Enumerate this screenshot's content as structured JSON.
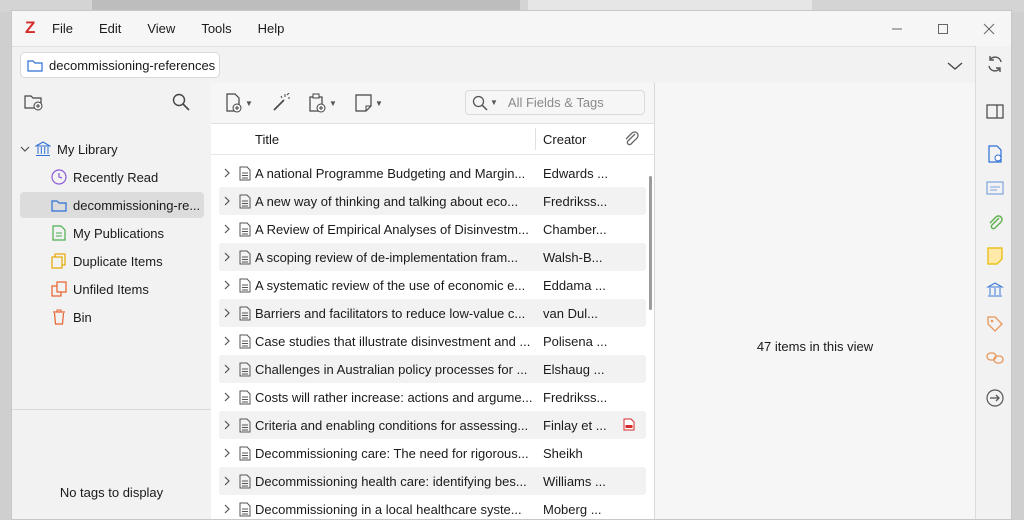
{
  "app": {
    "logo": "Z"
  },
  "menu": [
    "File",
    "Edit",
    "View",
    "Tools",
    "Help"
  ],
  "tab": {
    "label": "decommissioning-references"
  },
  "sidebar": {
    "library": "My Library",
    "items": [
      {
        "label": "Recently Read",
        "icon": "clock-icon"
      },
      {
        "label": "decommissioning-re...",
        "icon": "folder-icon",
        "selected": true
      },
      {
        "label": "My Publications",
        "icon": "publications-icon"
      },
      {
        "label": "Duplicate Items",
        "icon": "duplicate-icon"
      },
      {
        "label": "Unfiled Items",
        "icon": "unfiled-icon"
      },
      {
        "label": "Bin",
        "icon": "trash-icon"
      }
    ],
    "tags_message": "No tags to display"
  },
  "search": {
    "placeholder": "All Fields & Tags"
  },
  "columns": {
    "title": "Title",
    "creator": "Creator"
  },
  "rows": [
    {
      "title": "A national Programme Budgeting and Margin...",
      "creator": "Edwards ...",
      "pdf": false
    },
    {
      "title": "A new way of thinking and talking about eco...",
      "creator": "Fredrikss...",
      "pdf": false
    },
    {
      "title": "A Review of Empirical Analyses of Disinvestm...",
      "creator": "Chamber...",
      "pdf": false
    },
    {
      "title": "A scoping review of de-implementation fram...",
      "creator": "Walsh-B...",
      "pdf": false
    },
    {
      "title": "A systematic review of the use of economic e...",
      "creator": "Eddama ...",
      "pdf": false
    },
    {
      "title": "Barriers and facilitators to reduce low-value c...",
      "creator": "van Dul...",
      "pdf": false
    },
    {
      "title": "Case studies that illustrate disinvestment and ...",
      "creator": "Polisena ...",
      "pdf": false
    },
    {
      "title": "Challenges in Australian policy processes for ...",
      "creator": "Elshaug ...",
      "pdf": false
    },
    {
      "title": "Costs will rather increase: actions and argume...",
      "creator": "Fredrikss...",
      "pdf": false
    },
    {
      "title": "Criteria and enabling conditions for assessing...",
      "creator": "Finlay et ...",
      "pdf": true
    },
    {
      "title": "Decommissioning care: The need for rigorous...",
      "creator": "Sheikh",
      "pdf": false
    },
    {
      "title": "Decommissioning health care: identifying bes...",
      "creator": "Williams ...",
      "pdf": false
    },
    {
      "title": "Decommissioning in a local healthcare syste...",
      "creator": "Moberg ...",
      "pdf": false
    }
  ],
  "item_pane": {
    "count_text": "47 items in this view"
  },
  "colors": {
    "accent": "#2d6fd6",
    "logo": "#d42a2a",
    "selected": "#dcdcdc"
  }
}
